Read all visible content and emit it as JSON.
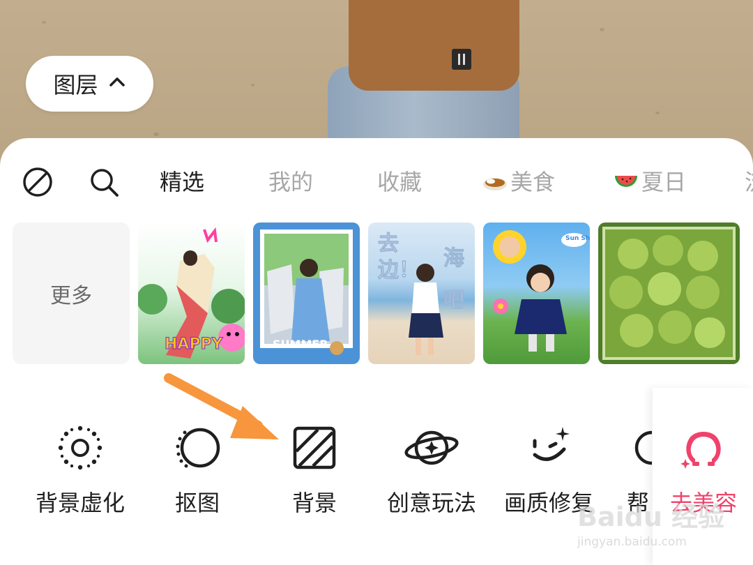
{
  "layer_button": {
    "label": "图层",
    "icon": "chevron-up-icon"
  },
  "tabs": [
    {
      "label": "精选",
      "active": true
    },
    {
      "label": "我的",
      "active": false
    },
    {
      "label": "收藏",
      "active": false
    },
    {
      "label": "美食",
      "emoji": "curry-icon",
      "active": false
    },
    {
      "label": "夏日",
      "emoji": "watermelon-icon",
      "active": false
    },
    {
      "label": "流",
      "active": false
    }
  ],
  "more_card": {
    "label": "更多"
  },
  "templates": [
    {
      "name": "template-happy",
      "overlay": "HAPPY"
    },
    {
      "name": "template-summer",
      "overlay": "SUMMER"
    },
    {
      "name": "template-seaside",
      "overlay_left": "去边！",
      "overlay_right": "海吧"
    },
    {
      "name": "template-sunshine",
      "overlay": "Sun Shine"
    },
    {
      "name": "template-green-grapes",
      "overlay": ""
    }
  ],
  "tools": [
    {
      "label": "背景虚化",
      "icon": "bokeh-icon"
    },
    {
      "label": "抠图",
      "icon": "cutout-icon"
    },
    {
      "label": "背景",
      "icon": "background-icon"
    },
    {
      "label": "创意玩法",
      "icon": "planet-icon"
    },
    {
      "label": "画质修复",
      "icon": "smile-sparkle-icon"
    },
    {
      "label": "帮",
      "icon": "partial-icon"
    }
  ],
  "beauty_tool": {
    "label": "去美容",
    "icon": "beauty-logo-icon"
  },
  "watermark": {
    "brand": "Baidu 经验",
    "url": "jingyan.baidu.com"
  },
  "colors": {
    "accent": "#f0426a",
    "arrow": "#f7963c",
    "text_active": "#1f1f1f",
    "text_muted": "#a7a7a7"
  }
}
